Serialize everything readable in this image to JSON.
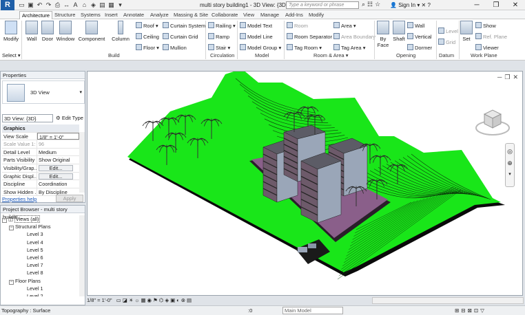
{
  "window": {
    "app_logo": "R",
    "title": "multi story building1 - 3D View: {3D}",
    "search_placeholder": "Type a keyword or phrase",
    "signin": "Sign In"
  },
  "tabs": [
    "Architecture",
    "Structure",
    "Systems",
    "Insert",
    "Annotate",
    "Analyze",
    "Massing & Site",
    "Collaborate",
    "View",
    "Manage",
    "Add-Ins",
    "Modify"
  ],
  "ribbon": {
    "modify": "Modify",
    "select": "Select ▾",
    "build_tools": [
      "Wall",
      "Door",
      "Window",
      "Component",
      "Column"
    ],
    "build_small": [
      "Roof ▾",
      "Ceiling",
      "Floor ▾",
      "Curtain System",
      "Curtain Grid",
      "Mullion"
    ],
    "circulation": [
      "Railing ▾",
      "Ramp",
      "Stair ▾"
    ],
    "model": [
      "Model Text",
      "Model Line",
      "Model Group ▾"
    ],
    "room": [
      "Room",
      "Room Separator",
      "Tag Room ▾",
      "Area ▾",
      "Area Boundary",
      "Tag Area ▾"
    ],
    "opening_big": [
      "By Face",
      "Shaft"
    ],
    "opening_small": [
      "Wall",
      "Vertical",
      "Dormer"
    ],
    "datum": [
      "Level",
      "Grid"
    ],
    "workplane_big": "Set",
    "workplane_small": [
      "Show",
      "Ref. Plane",
      "Viewer"
    ],
    "panels": [
      "Build",
      "Circulation",
      "Model",
      "Room & Area ▾",
      "Opening",
      "Datum",
      "Work Plane"
    ]
  },
  "properties": {
    "header": "Properties",
    "type_name": "3D View",
    "instance": "3D View: {3D}",
    "edit_type": "Edit Type",
    "group": "Graphics",
    "rows": [
      {
        "k": "View Scale",
        "v": "1/8\" = 1'-0\""
      },
      {
        "k": "Scale Value   1:",
        "v": "96"
      },
      {
        "k": "Detail Level",
        "v": "Medium"
      },
      {
        "k": "Parts Visibility",
        "v": "Show Original"
      },
      {
        "k": "Visibility/Grap...",
        "v": "Edit..."
      },
      {
        "k": "Graphic Displ...",
        "v": "Edit..."
      },
      {
        "k": "Discipline",
        "v": "Coordination"
      },
      {
        "k": "Show Hidden ...",
        "v": "By Discipline"
      }
    ],
    "help": "Properties help",
    "apply": "Apply"
  },
  "browser": {
    "header": "Project Browser - multi story buildin...",
    "items": [
      "Views (all)",
      "Structural Plans",
      "Level 3",
      "Level 4",
      "Level 5",
      "Level 6",
      "Level 7",
      "Level 8",
      "Floor Plans",
      "Level 1",
      "Level 2"
    ]
  },
  "view_control": {
    "scale": "1/8\" = 1'-0\""
  },
  "status": {
    "left": "Topography : Surface",
    "coord": ":0",
    "model": "Main Model"
  },
  "colors": {
    "terrain": "#19e619",
    "slab": "#8a5f8a",
    "building": "#9aa6b8"
  }
}
